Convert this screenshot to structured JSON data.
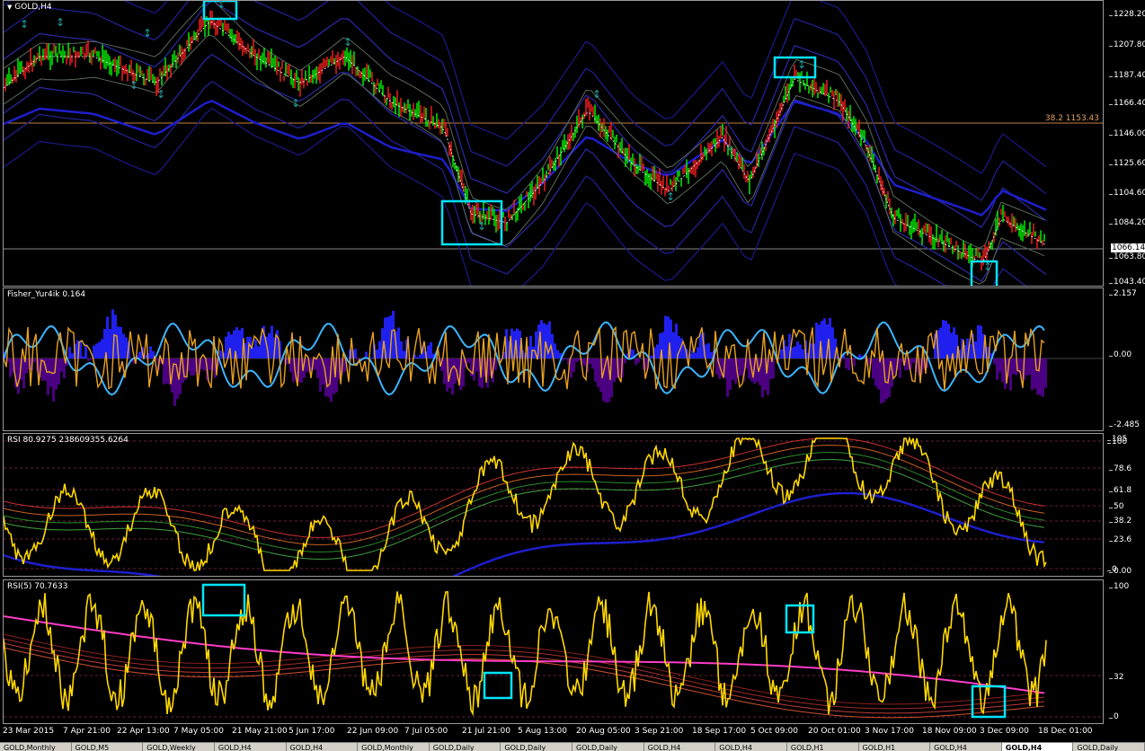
{
  "main": {
    "title": "GOLD,H4",
    "fib_label": "38.2 1153.43",
    "current_price": "1066.14",
    "scale": [
      "1228.20",
      "1207.80",
      "1187.40",
      "1166.40",
      "1146.00",
      "1125.60",
      "1104.60",
      "1084.20",
      "1066.14",
      "1063.80",
      "1043.40"
    ]
  },
  "fisher": {
    "title": "Fisher_Yur4ik 0.164",
    "scale": [
      "2.157",
      "0.00",
      "-2.485"
    ]
  },
  "rsi_multi": {
    "title": "RSI 80.9275 238609355.6264",
    "scale": [
      "105",
      "100",
      "78.6",
      "61.8",
      "50",
      "38.2",
      "23.6",
      "0",
      "0.00"
    ]
  },
  "rsi5": {
    "title": "RSI(5) 70.7633",
    "scale": [
      "100",
      "32",
      "0"
    ]
  },
  "time_axis": [
    "23 Mar 2015",
    "7 Apr 21:00",
    "22 Apr 13:00",
    "7 May 05:00",
    "21 May 21:00",
    "5 Jun 17:00",
    "22 Jun 09:00",
    "7 Jul 05:00",
    "21 Jul 21:00",
    "5 Aug 13:00",
    "20 Aug 05:00",
    "3 Sep 21:00",
    "18 Sep 17:00",
    "5 Oct 09:00",
    "20 Oct 01:00",
    "3 Nov 17:00",
    "18 Nov 09:00",
    "3 Dec 09:00",
    "18 Dec 01:00"
  ],
  "tabs": [
    "GOLD,Monthly",
    "GOLD,M5",
    "GOLD,Weekly",
    "GOLD,H4",
    "GOLD,H4",
    "GOLD,Monthly",
    "GOLD,Daily",
    "GOLD,Daily",
    "GOLD,Daily",
    "GOLD,H4",
    "GOLD,H4",
    "GOLD,H1",
    "GOLD,H1",
    "GOLD,H4",
    "GOLD,H4",
    "GOLD,Daily"
  ],
  "active_tab_index": 14,
  "colors": {
    "up_candle": "#00ff00",
    "down_candle": "#ff0000",
    "highlight_box": "#00e5ff",
    "rsi_line": "#ffd700",
    "fisher_fill": "#0000ff",
    "ma_blue": "#1e1ecc"
  }
}
